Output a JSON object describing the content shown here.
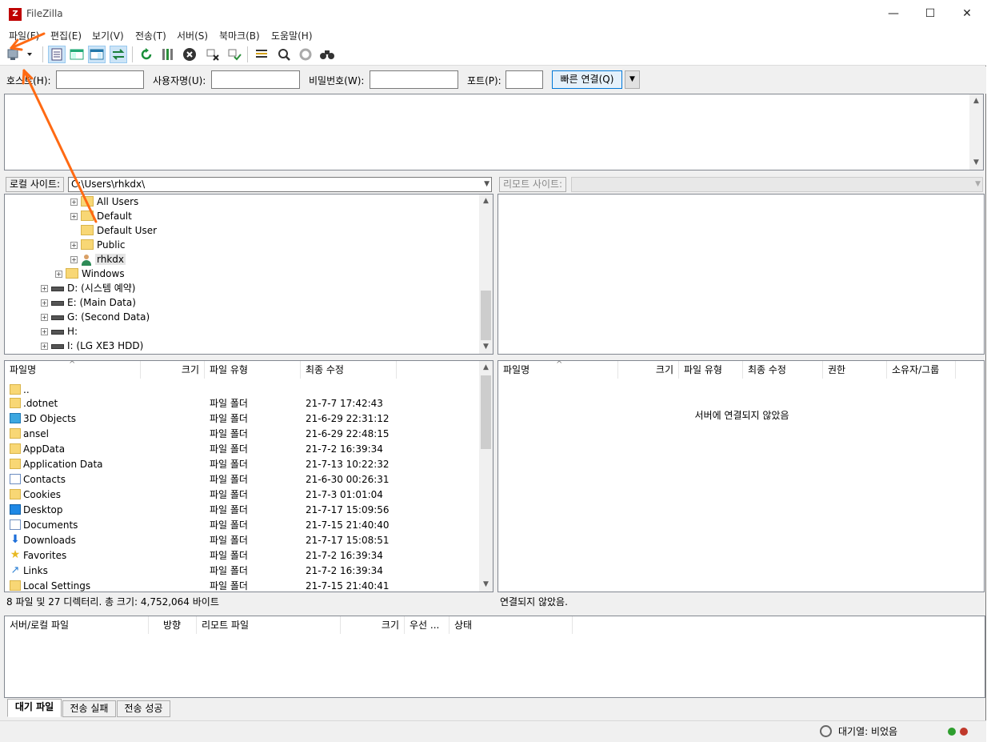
{
  "window": {
    "title": "FileZilla",
    "app_icon_letter": "Z"
  },
  "window_controls": {
    "minimize": "—",
    "maximize": "☐",
    "close": "✕"
  },
  "menu": [
    {
      "label": "파일(F)"
    },
    {
      "label": "편집(E)"
    },
    {
      "label": "보기(V)"
    },
    {
      "label": "전송(T)"
    },
    {
      "label": "서버(S)"
    },
    {
      "label": "북마크(B)"
    },
    {
      "label": "도움말(H)"
    }
  ],
  "quickconnect": {
    "host_label": "호스트(H):",
    "user_label": "사용자명(U):",
    "pass_label": "비밀번호(W):",
    "port_label": "포트(P):",
    "host_value": "",
    "user_value": "",
    "pass_value": "",
    "port_value": "",
    "connect_label": "빠른 연결(Q)",
    "dropdown_glyph": "▼"
  },
  "local": {
    "site_label": "로컬 사이트:",
    "path": "C:\\Users\\rhkdx\\",
    "tree": [
      {
        "label": "All Users",
        "type": "folder",
        "expandable": true
      },
      {
        "label": "Default",
        "type": "folder",
        "expandable": true
      },
      {
        "label": "Default User",
        "type": "folder",
        "expandable": false
      },
      {
        "label": "Public",
        "type": "folder",
        "expandable": true
      },
      {
        "label": "rhkdx",
        "type": "user",
        "expandable": true
      },
      {
        "label": "Windows",
        "type": "folder",
        "expandable": true
      },
      {
        "label": "D: (시스템 예약)",
        "type": "drive",
        "expandable": true
      },
      {
        "label": "E: (Main Data)",
        "type": "drive",
        "expandable": true
      },
      {
        "label": "G: (Second Data)",
        "type": "drive",
        "expandable": true
      },
      {
        "label": "H:",
        "type": "drive",
        "expandable": true
      },
      {
        "label": "I: (LG XE3 HDD)",
        "type": "drive",
        "expandable": true
      }
    ],
    "columns": {
      "name": "파일명",
      "size": "크기",
      "type": "파일 유형",
      "modified": "최종 수정"
    },
    "files": [
      {
        "name": "..",
        "type": "",
        "modified": "",
        "icon": "folder-icon"
      },
      {
        "name": ".dotnet",
        "type": "파일 폴더",
        "modified": "21-7-7 17:42:43",
        "icon": "folder-icon"
      },
      {
        "name": "3D Objects",
        "type": "파일 폴더",
        "modified": "21-6-29 22:31:12",
        "icon": "3d-objects-icon"
      },
      {
        "name": "ansel",
        "type": "파일 폴더",
        "modified": "21-6-29 22:48:15",
        "icon": "folder-icon"
      },
      {
        "name": "AppData",
        "type": "파일 폴더",
        "modified": "21-7-2 16:39:34",
        "icon": "folder-icon"
      },
      {
        "name": "Application Data",
        "type": "파일 폴더",
        "modified": "21-7-13 10:22:32",
        "icon": "folder-icon"
      },
      {
        "name": "Contacts",
        "type": "파일 폴더",
        "modified": "21-6-30 00:26:31",
        "icon": "contacts-icon"
      },
      {
        "name": "Cookies",
        "type": "파일 폴더",
        "modified": "21-7-3 01:01:04",
        "icon": "folder-icon"
      },
      {
        "name": "Desktop",
        "type": "파일 폴더",
        "modified": "21-7-17 15:09:56",
        "icon": "desktop-icon"
      },
      {
        "name": "Documents",
        "type": "파일 폴더",
        "modified": "21-7-15 21:40:40",
        "icon": "documents-icon"
      },
      {
        "name": "Downloads",
        "type": "파일 폴더",
        "modified": "21-7-17 15:08:51",
        "icon": "downloads-icon"
      },
      {
        "name": "Favorites",
        "type": "파일 폴더",
        "modified": "21-7-2 16:39:34",
        "icon": "favorites-icon"
      },
      {
        "name": "Links",
        "type": "파일 폴더",
        "modified": "21-7-2 16:39:34",
        "icon": "links-icon"
      },
      {
        "name": "Local Settings",
        "type": "파일 폴더",
        "modified": "21-7-15 21:40:41",
        "icon": "folder-icon"
      }
    ],
    "status": "8 파일 및 27 디렉터리. 총 크기: 4,752,064 바이트"
  },
  "remote": {
    "site_label": "리모트 사이트:",
    "path": "",
    "columns": {
      "name": "파일명",
      "size": "크기",
      "type": "파일 유형",
      "modified": "최종 수정",
      "perms": "권한",
      "owner": "소유자/그룹"
    },
    "empty_message": "서버에 연결되지 않았음",
    "status": "연결되지 않았음."
  },
  "queue": {
    "columns": {
      "server_local": "서버/로컬 파일",
      "direction": "방향",
      "remote_file": "리모트 파일",
      "size": "크기",
      "priority": "우선 ...",
      "status": "상태"
    },
    "tabs": [
      {
        "label": "대기 파일",
        "active": true
      },
      {
        "label": "전송 실패",
        "active": false
      },
      {
        "label": "전송 성공",
        "active": false
      }
    ]
  },
  "statusbar": {
    "queue_text": "대기열: 비었음",
    "led_colors": [
      "#2e9e2e",
      "#c0392b"
    ]
  },
  "annotation_color": "#ff6a13"
}
